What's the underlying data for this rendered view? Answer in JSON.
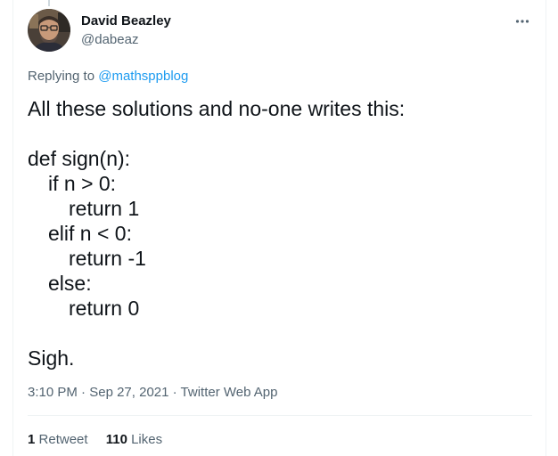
{
  "tweet": {
    "author": {
      "name": "David Beazley",
      "handle": "@dabeaz",
      "avatar_icon": "profile-photo-icon"
    },
    "more_icon": "more-options-icon",
    "replying_to": {
      "prefix": "Replying to",
      "mention": "@mathsppblog"
    },
    "body": {
      "intro": "All these solutions and no-one writes this:",
      "code": [
        "def sign(n):",
        "if n > 0:",
        "return 1",
        "elif n < 0:",
        "return -1",
        "else:",
        "return 0"
      ],
      "outro": "Sigh."
    },
    "meta": {
      "time": "3:10 PM",
      "separator": "·",
      "date": "Sep 27, 2021",
      "source": "Twitter Web App"
    },
    "stats": {
      "retweets_count": "1",
      "retweets_label": "Retweet",
      "likes_count": "110",
      "likes_label": "Likes"
    }
  },
  "colors": {
    "text_primary": "#0f1419",
    "text_secondary": "#536471",
    "accent": "#1d9bf0",
    "divider": "#eff3f4"
  }
}
